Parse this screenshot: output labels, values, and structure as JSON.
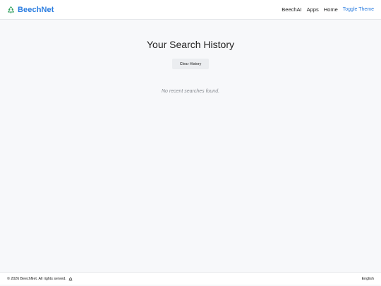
{
  "header": {
    "brand_name": "BeechNet",
    "brand_icon": "beech-tree-icon",
    "brand_color": "#2b7de0",
    "nav": [
      {
        "label": "BeechAI"
      },
      {
        "label": "Apps"
      },
      {
        "label": "Home"
      }
    ],
    "theme_toggle_label": "Toggle Theme"
  },
  "main": {
    "title": "Your Search History",
    "clear_button_label": "Clear History",
    "empty_message": "No recent searches found."
  },
  "footer": {
    "copyright": "© 2026 BeechNet. All rights served.",
    "footer_icon": "beech-tree-icon",
    "language": "English"
  }
}
